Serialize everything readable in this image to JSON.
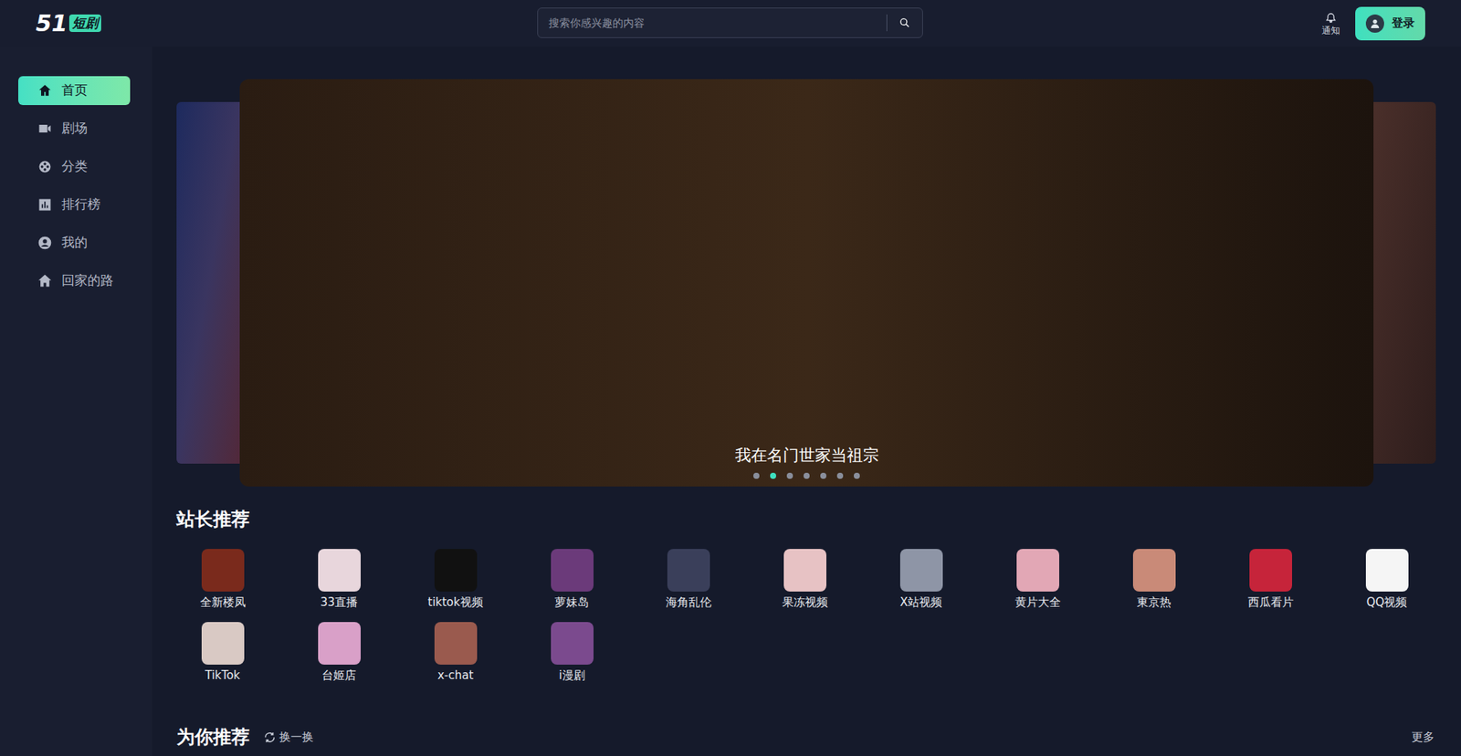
{
  "header": {
    "logo": {
      "number": "51",
      "text": "短剧"
    },
    "search": {
      "placeholder": "搜索你感兴趣的内容"
    },
    "notification": "通知",
    "login": "登录"
  },
  "sidebar": {
    "items": [
      {
        "label": "首页",
        "selected": true
      },
      {
        "label": "剧场",
        "selected": false
      },
      {
        "label": "分类",
        "selected": false
      },
      {
        "label": "排行榜",
        "selected": false
      },
      {
        "label": "我的",
        "selected": false
      },
      {
        "label": "回家的路",
        "selected": false
      }
    ]
  },
  "carousel": {
    "caption": "我在名门世家当祖宗",
    "dots": [
      {
        "selected": false
      },
      {
        "selected": true
      },
      {
        "selected": false
      },
      {
        "selected": false
      },
      {
        "selected": false
      },
      {
        "selected": false
      },
      {
        "selected": false
      }
    ]
  },
  "recommend": {
    "title": "站长推荐",
    "apps": [
      {
        "label": "全新楼凤",
        "color": "#7a2a1c"
      },
      {
        "label": "33直播",
        "color": "#e8d6dc"
      },
      {
        "label": "tiktok视频",
        "color": "#111111"
      },
      {
        "label": "萝妹岛",
        "color": "#6b3a7a"
      },
      {
        "label": "海角乱伦",
        "color": "#3a3f5a"
      },
      {
        "label": "果冻视频",
        "color": "#e7c2c4"
      },
      {
        "label": "X站视频",
        "color": "#8e95a6"
      },
      {
        "label": "黄片大全",
        "color": "#e2a7b5"
      },
      {
        "label": "東京热",
        "color": "#c98a78"
      },
      {
        "label": "西瓜看片",
        "color": "#c6243a"
      },
      {
        "label": "QQ视频",
        "color": "#f5f5f5"
      },
      {
        "label": "TikTok",
        "color": "#d9c9c4"
      },
      {
        "label": "台姬店",
        "color": "#d9a0c8"
      },
      {
        "label": "x-chat",
        "color": "#9a5a4e"
      },
      {
        "label": "i漫剧",
        "color": "#7b4a8e"
      }
    ]
  },
  "for_you": {
    "title": "为你推荐",
    "refresh": "换一换",
    "more": "更多"
  }
}
